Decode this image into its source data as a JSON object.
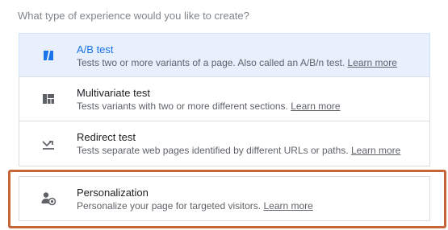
{
  "question": "What type of experience would you like to create?",
  "options": [
    {
      "title": "A/B test",
      "description": "Tests two or more variants of a page. Also called an A/B/n test.",
      "learn_more": "Learn more",
      "icon": "ab-test-icon",
      "selected": true
    },
    {
      "title": "Multivariate test",
      "description": "Tests variants with two or more different sections.",
      "learn_more": "Learn more",
      "icon": "multivariate-icon",
      "selected": false
    },
    {
      "title": "Redirect test",
      "description": "Tests separate web pages identified by different URLs or paths.",
      "learn_more": "Learn more",
      "icon": "redirect-icon",
      "selected": false
    },
    {
      "title": "Personalization",
      "description": "Personalize your page for targeted visitors.",
      "learn_more": "Learn more",
      "icon": "personalization-icon",
      "selected": false
    }
  ],
  "colors": {
    "accent": "#1a73e8",
    "selected_bg": "#e8f0fe",
    "highlight_border": "#c7653a"
  }
}
